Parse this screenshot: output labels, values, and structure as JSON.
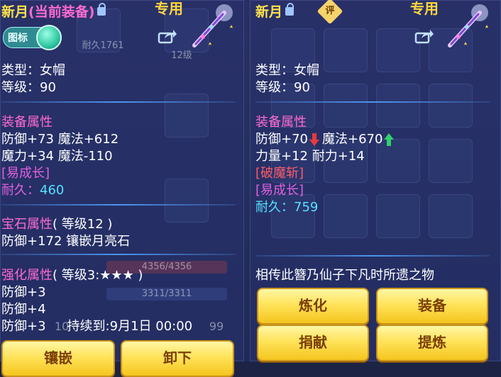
{
  "left": {
    "item_name": "新月",
    "current_tag": "(当前装备)",
    "special_label": "专用",
    "toggle_label": "图标",
    "type_line": "类型：女帽",
    "level_line": "等级：90",
    "equip_attr_title": "装备属性",
    "stat_line_1": "防御+73 魔法+612",
    "stat_line_2": "魔力+34 魔法-110",
    "tag_growth": "[易成长]",
    "durability_label": "耐久：",
    "durability_value": "460",
    "gem_title": "宝石属性",
    "gem_level": "( 等级12 )",
    "gem_line": "防御+172 镶嵌月亮石",
    "enhance_title": "强化属性",
    "enhance_level": "( 等级3:★★★ )",
    "enhance_1": "防御+3",
    "enhance_2": "防御+4",
    "enhance_3": "防御+3",
    "duration_label": "持续到:9月1日 00:00",
    "btn_inlay": "镶嵌",
    "btn_unequip": "卸下",
    "bg_bar_1": "4356/4356",
    "bg_bar_2": "3311/3311",
    "bg_fragment_1": "10",
    "bg_fragment_2": "99",
    "bg_fragment_3": "耐久1761",
    "bg_slot_level": "12级"
  },
  "right": {
    "item_name": "新月",
    "rate_label": "评",
    "special_label": "专用",
    "type_line": "类型：女帽",
    "level_line": "等级：90",
    "equip_attr_title": "装备属性",
    "stat_def": "防御+70",
    "stat_magic": "魔法+670",
    "stat_line_2": "力量+12 耐力+14",
    "tag_special": "[破魔斩]",
    "tag_growth": "[易成长]",
    "durability_label": "耐久：",
    "durability_value": "759",
    "description": "相传此簪乃仙子下凡时所遗之物",
    "btn_refine": "炼化",
    "btn_equip": "装备",
    "btn_donate": "捐献",
    "btn_extract": "提炼"
  },
  "colors": {
    "title_yellow": "#ffe24a",
    "section_pink": "#ff6ad0",
    "durability_cyan": "#58e0ff",
    "tag_red": "#ff5a6a",
    "tag_magenta": "#e060e0",
    "button_gold": "#ffe35a",
    "button_text": "#7a3e07",
    "down_arrow": "#e63a3a",
    "up_arrow": "#2fd06a"
  },
  "icons": {
    "lock": "lock-icon",
    "share": "share-icon",
    "weapon": "hairpin-weapon-icon",
    "rate": "rate-badge-icon",
    "down_arrow": "arrow-down-icon",
    "up_arrow": "arrow-up-icon"
  }
}
